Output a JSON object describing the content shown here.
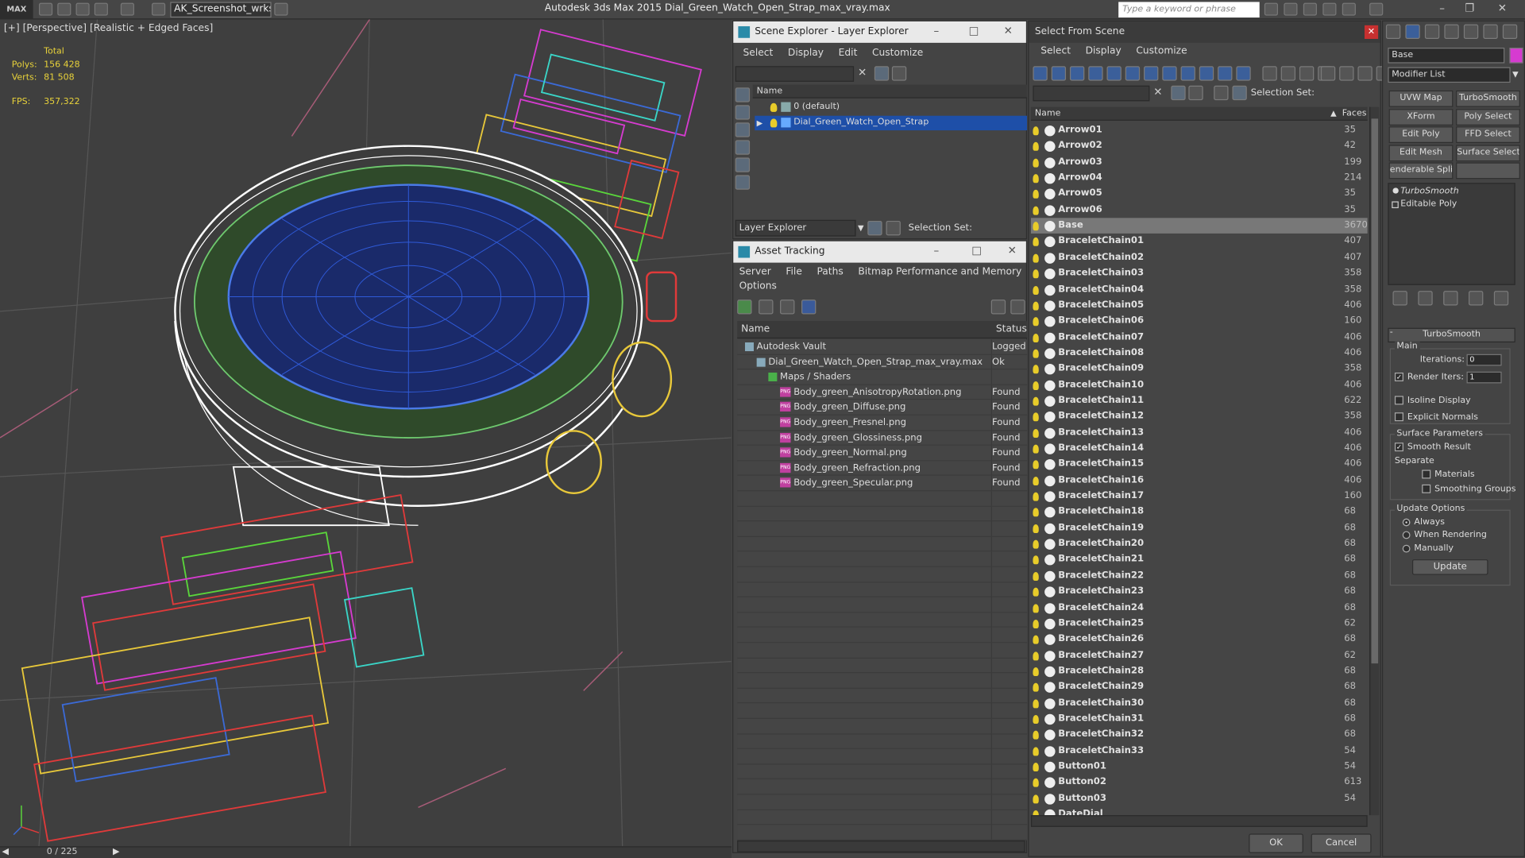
{
  "app": {
    "logo": "MAX",
    "project": "AK_Screenshot_wrksp",
    "title": "Autodesk 3ds Max  2015    Dial_Green_Watch_Open_Strap_max_vray.max",
    "search_placeholder": "Type a keyword or phrase"
  },
  "viewport": {
    "label": "[+] [Perspective] [Realistic + Edged Faces]",
    "stats": {
      "total_label": "Total",
      "polys_label": "Polys:",
      "polys_value": "156 428",
      "verts_label": "Verts:",
      "verts_value": "81 508",
      "fps_label": "FPS:",
      "fps_value": "357,322"
    },
    "timeslider": "0 / 225",
    "background": "#3f3f3f"
  },
  "scene_explorer": {
    "title": "Scene Explorer - Layer Explorer",
    "menu": [
      "Select",
      "Display",
      "Edit",
      "Customize"
    ],
    "column_name": "Name",
    "layers": [
      "0 (default)",
      "Dial_Green_Watch_Open_Strap"
    ],
    "footer_dropdown": "Layer Explorer",
    "selection_set_label": "Selection Set:"
  },
  "asset_tracking": {
    "title": "Asset Tracking",
    "menu": [
      "Server",
      "File",
      "Paths",
      "Bitmap Performance and Memory"
    ],
    "menu2": "Options",
    "col_name": "Name",
    "col_status": "Status",
    "rows": [
      {
        "name": "Autodesk Vault",
        "status": "Logged",
        "indent": 0
      },
      {
        "name": "Dial_Green_Watch_Open_Strap_max_vray.max",
        "status": "Ok",
        "indent": 1
      },
      {
        "name": "Maps / Shaders",
        "status": "",
        "indent": 2
      },
      {
        "name": "Body_green_AnisotropyRotation.png",
        "status": "Found",
        "indent": 3
      },
      {
        "name": "Body_green_Diffuse.png",
        "status": "Found",
        "indent": 3
      },
      {
        "name": "Body_green_Fresnel.png",
        "status": "Found",
        "indent": 3
      },
      {
        "name": "Body_green_Glossiness.png",
        "status": "Found",
        "indent": 3
      },
      {
        "name": "Body_green_Normal.png",
        "status": "Found",
        "indent": 3
      },
      {
        "name": "Body_green_Refraction.png",
        "status": "Found",
        "indent": 3
      },
      {
        "name": "Body_green_Specular.png",
        "status": "Found",
        "indent": 3
      }
    ]
  },
  "select_from_scene": {
    "title": "Select From Scene",
    "menu": [
      "Select",
      "Display",
      "Customize"
    ],
    "selection_set_label": "Selection Set:",
    "col_name": "Name",
    "col_faces": "Faces",
    "items": [
      {
        "name": "Arrow01",
        "faces": "35"
      },
      {
        "name": "Arrow02",
        "faces": "42"
      },
      {
        "name": "Arrow03",
        "faces": "199"
      },
      {
        "name": "Arrow04",
        "faces": "214"
      },
      {
        "name": "Arrow05",
        "faces": "35"
      },
      {
        "name": "Arrow06",
        "faces": "35"
      },
      {
        "name": "Base",
        "faces": "3670"
      },
      {
        "name": "BraceletChain01",
        "faces": "407"
      },
      {
        "name": "BraceletChain02",
        "faces": "407"
      },
      {
        "name": "BraceletChain03",
        "faces": "358"
      },
      {
        "name": "BraceletChain04",
        "faces": "358"
      },
      {
        "name": "BraceletChain05",
        "faces": "406"
      },
      {
        "name": "BraceletChain06",
        "faces": "160"
      },
      {
        "name": "BraceletChain07",
        "faces": "406"
      },
      {
        "name": "BraceletChain08",
        "faces": "406"
      },
      {
        "name": "BraceletChain09",
        "faces": "358"
      },
      {
        "name": "BraceletChain10",
        "faces": "406"
      },
      {
        "name": "BraceletChain11",
        "faces": "622"
      },
      {
        "name": "BraceletChain12",
        "faces": "358"
      },
      {
        "name": "BraceletChain13",
        "faces": "406"
      },
      {
        "name": "BraceletChain14",
        "faces": "406"
      },
      {
        "name": "BraceletChain15",
        "faces": "406"
      },
      {
        "name": "BraceletChain16",
        "faces": "406"
      },
      {
        "name": "BraceletChain17",
        "faces": "160"
      },
      {
        "name": "BraceletChain18",
        "faces": "68"
      },
      {
        "name": "BraceletChain19",
        "faces": "68"
      },
      {
        "name": "BraceletChain20",
        "faces": "68"
      },
      {
        "name": "BraceletChain21",
        "faces": "68"
      },
      {
        "name": "BraceletChain22",
        "faces": "68"
      },
      {
        "name": "BraceletChain23",
        "faces": "68"
      },
      {
        "name": "BraceletChain24",
        "faces": "68"
      },
      {
        "name": "BraceletChain25",
        "faces": "62"
      },
      {
        "name": "BraceletChain26",
        "faces": "68"
      },
      {
        "name": "BraceletChain27",
        "faces": "62"
      },
      {
        "name": "BraceletChain28",
        "faces": "68"
      },
      {
        "name": "BraceletChain29",
        "faces": "68"
      },
      {
        "name": "BraceletChain30",
        "faces": "68"
      },
      {
        "name": "BraceletChain31",
        "faces": "68"
      },
      {
        "name": "BraceletChain32",
        "faces": "68"
      },
      {
        "name": "BraceletChain33",
        "faces": "54"
      },
      {
        "name": "Button01",
        "faces": "54"
      },
      {
        "name": "Button02",
        "faces": "613"
      },
      {
        "name": "Button03",
        "faces": "54"
      },
      {
        "name": "DateDial",
        "faces": ""
      }
    ],
    "selected": "Base",
    "ok_label": "OK",
    "cancel_label": "Cancel"
  },
  "command_panel": {
    "object_name": "Base",
    "modifier_list": "Modifier List",
    "buttons": [
      "UVW Map",
      "TurboSmooth",
      "XForm",
      "Poly Select",
      "Edit Poly",
      "FFD Select",
      "Edit Mesh",
      "Surface Select",
      "enderable Splir",
      ""
    ],
    "stack": [
      "TurboSmooth",
      "Editable Poly"
    ],
    "rollout_title": "TurboSmooth",
    "main_label": "Main",
    "iterations_label": "Iterations:",
    "iterations_value": "0",
    "render_iters_label": "Render Iters:",
    "render_iters_value": "1",
    "isoline": "Isoline Display",
    "explicit": "Explicit Normals",
    "surface_params": "Surface Parameters",
    "smooth_result": "Smooth Result",
    "separate": "Separate",
    "materials": "Materials",
    "smoothing_groups": "Smoothing Groups",
    "update_options": "Update Options",
    "always": "Always",
    "when_rendering": "When Rendering",
    "manually": "Manually",
    "update_button": "Update"
  },
  "colors": {
    "accent_select": "#1e4fa8",
    "accent_pink": "#d63bd0",
    "stat_yellow": "#e8d23a"
  }
}
